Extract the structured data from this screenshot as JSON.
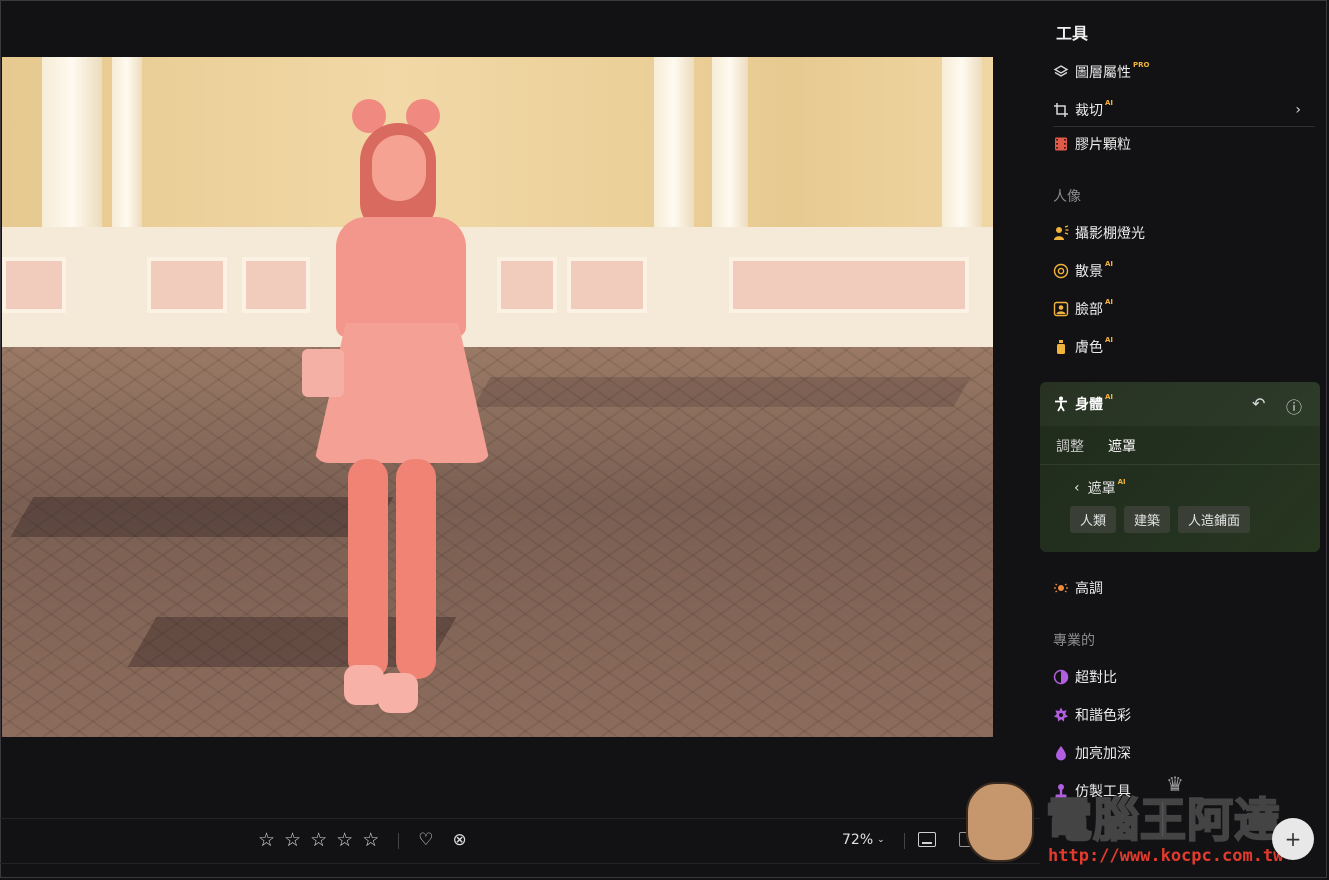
{
  "panel": {
    "title": "工具",
    "tools_top": [
      {
        "label": "圖層屬性",
        "badge": "PRO",
        "icon": "layers-icon",
        "color": "#d8d8d8"
      },
      {
        "label": "裁切",
        "badge": "AI",
        "icon": "crop-icon",
        "color": "#d8d8d8"
      },
      {
        "label": "膠片顆粒",
        "badge": "",
        "icon": "film-grain-icon",
        "color": "#e05a4a"
      }
    ],
    "section_portrait": "人像",
    "tools_portrait": [
      {
        "label": "攝影棚燈光",
        "badge": "",
        "icon": "studio-light-icon",
        "color": "#f2b33d"
      },
      {
        "label": "散景",
        "badge": "AI",
        "icon": "bokeh-icon",
        "color": "#f2b33d"
      },
      {
        "label": "臉部",
        "badge": "AI",
        "icon": "face-icon",
        "color": "#f2b33d"
      },
      {
        "label": "膚色",
        "badge": "AI",
        "icon": "skin-tone-icon",
        "color": "#f2b33d"
      }
    ],
    "body_card": {
      "label": "身體",
      "badge": "AI",
      "tabs": [
        "調整",
        "遮罩"
      ],
      "active_tab": "遮罩",
      "mask_back_label": "遮罩",
      "mask_badge": "AI",
      "chips": [
        "人類",
        "建築",
        "人造鋪面"
      ]
    },
    "tool_highlights": {
      "label": "高調",
      "icon": "highlights-icon",
      "color": "#f08a3d"
    },
    "section_pro": "專業的",
    "tools_pro": [
      {
        "label": "超對比",
        "icon": "super-contrast-icon",
        "color": "#b25ee0"
      },
      {
        "label": "和諧色彩",
        "icon": "color-harmony-icon",
        "color": "#b25ee0"
      },
      {
        "label": "加亮加深",
        "icon": "dodge-burn-icon",
        "color": "#b25ee0"
      },
      {
        "label": "仿製工具",
        "icon": "clone-icon",
        "color": "#b25ee0"
      }
    ]
  },
  "bottombar": {
    "rating_stars": 5,
    "rating_value": 0,
    "zoom": "72%"
  },
  "watermark": {
    "text": "電腦王阿達",
    "url": "http://www.kocpc.com.tw"
  }
}
